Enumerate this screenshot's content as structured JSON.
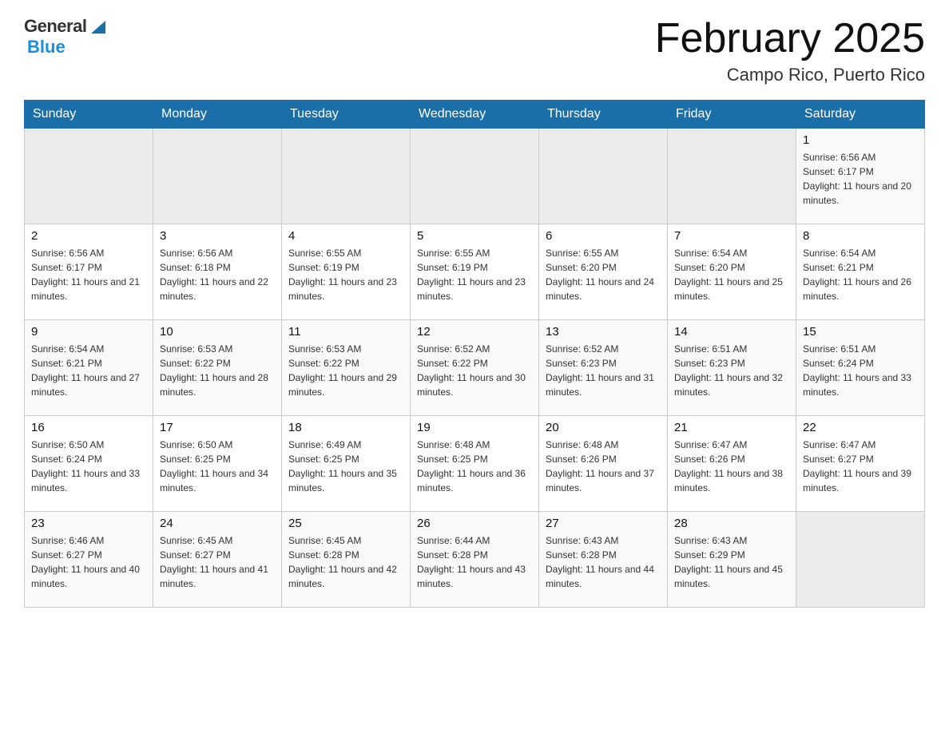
{
  "header": {
    "logo_general": "General",
    "logo_blue": "Blue",
    "month_title": "February 2025",
    "location": "Campo Rico, Puerto Rico"
  },
  "days_of_week": [
    "Sunday",
    "Monday",
    "Tuesday",
    "Wednesday",
    "Thursday",
    "Friday",
    "Saturday"
  ],
  "weeks": [
    {
      "days": [
        {
          "number": "",
          "sunrise": "",
          "sunset": "",
          "daylight": "",
          "empty": true
        },
        {
          "number": "",
          "sunrise": "",
          "sunset": "",
          "daylight": "",
          "empty": true
        },
        {
          "number": "",
          "sunrise": "",
          "sunset": "",
          "daylight": "",
          "empty": true
        },
        {
          "number": "",
          "sunrise": "",
          "sunset": "",
          "daylight": "",
          "empty": true
        },
        {
          "number": "",
          "sunrise": "",
          "sunset": "",
          "daylight": "",
          "empty": true
        },
        {
          "number": "",
          "sunrise": "",
          "sunset": "",
          "daylight": "",
          "empty": true
        },
        {
          "number": "1",
          "sunrise": "Sunrise: 6:56 AM",
          "sunset": "Sunset: 6:17 PM",
          "daylight": "Daylight: 11 hours and 20 minutes.",
          "empty": false
        }
      ]
    },
    {
      "days": [
        {
          "number": "2",
          "sunrise": "Sunrise: 6:56 AM",
          "sunset": "Sunset: 6:17 PM",
          "daylight": "Daylight: 11 hours and 21 minutes.",
          "empty": false
        },
        {
          "number": "3",
          "sunrise": "Sunrise: 6:56 AM",
          "sunset": "Sunset: 6:18 PM",
          "daylight": "Daylight: 11 hours and 22 minutes.",
          "empty": false
        },
        {
          "number": "4",
          "sunrise": "Sunrise: 6:55 AM",
          "sunset": "Sunset: 6:19 PM",
          "daylight": "Daylight: 11 hours and 23 minutes.",
          "empty": false
        },
        {
          "number": "5",
          "sunrise": "Sunrise: 6:55 AM",
          "sunset": "Sunset: 6:19 PM",
          "daylight": "Daylight: 11 hours and 23 minutes.",
          "empty": false
        },
        {
          "number": "6",
          "sunrise": "Sunrise: 6:55 AM",
          "sunset": "Sunset: 6:20 PM",
          "daylight": "Daylight: 11 hours and 24 minutes.",
          "empty": false
        },
        {
          "number": "7",
          "sunrise": "Sunrise: 6:54 AM",
          "sunset": "Sunset: 6:20 PM",
          "daylight": "Daylight: 11 hours and 25 minutes.",
          "empty": false
        },
        {
          "number": "8",
          "sunrise": "Sunrise: 6:54 AM",
          "sunset": "Sunset: 6:21 PM",
          "daylight": "Daylight: 11 hours and 26 minutes.",
          "empty": false
        }
      ]
    },
    {
      "days": [
        {
          "number": "9",
          "sunrise": "Sunrise: 6:54 AM",
          "sunset": "Sunset: 6:21 PM",
          "daylight": "Daylight: 11 hours and 27 minutes.",
          "empty": false
        },
        {
          "number": "10",
          "sunrise": "Sunrise: 6:53 AM",
          "sunset": "Sunset: 6:22 PM",
          "daylight": "Daylight: 11 hours and 28 minutes.",
          "empty": false
        },
        {
          "number": "11",
          "sunrise": "Sunrise: 6:53 AM",
          "sunset": "Sunset: 6:22 PM",
          "daylight": "Daylight: 11 hours and 29 minutes.",
          "empty": false
        },
        {
          "number": "12",
          "sunrise": "Sunrise: 6:52 AM",
          "sunset": "Sunset: 6:22 PM",
          "daylight": "Daylight: 11 hours and 30 minutes.",
          "empty": false
        },
        {
          "number": "13",
          "sunrise": "Sunrise: 6:52 AM",
          "sunset": "Sunset: 6:23 PM",
          "daylight": "Daylight: 11 hours and 31 minutes.",
          "empty": false
        },
        {
          "number": "14",
          "sunrise": "Sunrise: 6:51 AM",
          "sunset": "Sunset: 6:23 PM",
          "daylight": "Daylight: 11 hours and 32 minutes.",
          "empty": false
        },
        {
          "number": "15",
          "sunrise": "Sunrise: 6:51 AM",
          "sunset": "Sunset: 6:24 PM",
          "daylight": "Daylight: 11 hours and 33 minutes.",
          "empty": false
        }
      ]
    },
    {
      "days": [
        {
          "number": "16",
          "sunrise": "Sunrise: 6:50 AM",
          "sunset": "Sunset: 6:24 PM",
          "daylight": "Daylight: 11 hours and 33 minutes.",
          "empty": false
        },
        {
          "number": "17",
          "sunrise": "Sunrise: 6:50 AM",
          "sunset": "Sunset: 6:25 PM",
          "daylight": "Daylight: 11 hours and 34 minutes.",
          "empty": false
        },
        {
          "number": "18",
          "sunrise": "Sunrise: 6:49 AM",
          "sunset": "Sunset: 6:25 PM",
          "daylight": "Daylight: 11 hours and 35 minutes.",
          "empty": false
        },
        {
          "number": "19",
          "sunrise": "Sunrise: 6:48 AM",
          "sunset": "Sunset: 6:25 PM",
          "daylight": "Daylight: 11 hours and 36 minutes.",
          "empty": false
        },
        {
          "number": "20",
          "sunrise": "Sunrise: 6:48 AM",
          "sunset": "Sunset: 6:26 PM",
          "daylight": "Daylight: 11 hours and 37 minutes.",
          "empty": false
        },
        {
          "number": "21",
          "sunrise": "Sunrise: 6:47 AM",
          "sunset": "Sunset: 6:26 PM",
          "daylight": "Daylight: 11 hours and 38 minutes.",
          "empty": false
        },
        {
          "number": "22",
          "sunrise": "Sunrise: 6:47 AM",
          "sunset": "Sunset: 6:27 PM",
          "daylight": "Daylight: 11 hours and 39 minutes.",
          "empty": false
        }
      ]
    },
    {
      "days": [
        {
          "number": "23",
          "sunrise": "Sunrise: 6:46 AM",
          "sunset": "Sunset: 6:27 PM",
          "daylight": "Daylight: 11 hours and 40 minutes.",
          "empty": false
        },
        {
          "number": "24",
          "sunrise": "Sunrise: 6:45 AM",
          "sunset": "Sunset: 6:27 PM",
          "daylight": "Daylight: 11 hours and 41 minutes.",
          "empty": false
        },
        {
          "number": "25",
          "sunrise": "Sunrise: 6:45 AM",
          "sunset": "Sunset: 6:28 PM",
          "daylight": "Daylight: 11 hours and 42 minutes.",
          "empty": false
        },
        {
          "number": "26",
          "sunrise": "Sunrise: 6:44 AM",
          "sunset": "Sunset: 6:28 PM",
          "daylight": "Daylight: 11 hours and 43 minutes.",
          "empty": false
        },
        {
          "number": "27",
          "sunrise": "Sunrise: 6:43 AM",
          "sunset": "Sunset: 6:28 PM",
          "daylight": "Daylight: 11 hours and 44 minutes.",
          "empty": false
        },
        {
          "number": "28",
          "sunrise": "Sunrise: 6:43 AM",
          "sunset": "Sunset: 6:29 PM",
          "daylight": "Daylight: 11 hours and 45 minutes.",
          "empty": false
        },
        {
          "number": "",
          "sunrise": "",
          "sunset": "",
          "daylight": "",
          "empty": true
        }
      ]
    }
  ],
  "colors": {
    "header_bg": "#1a6fa8",
    "header_text": "#ffffff",
    "border": "#aaaaaa",
    "row_odd": "#f5f5f5",
    "row_even": "#ffffff"
  }
}
